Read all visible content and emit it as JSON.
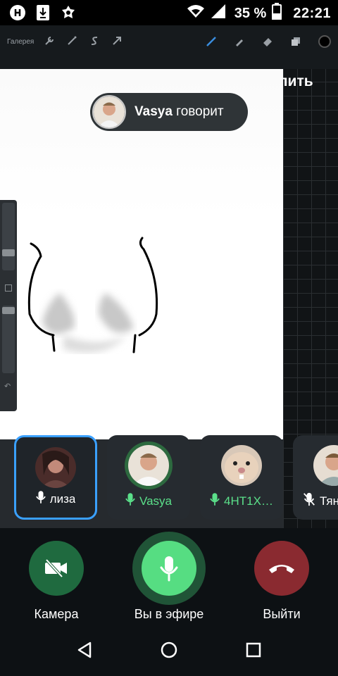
{
  "status_bar": {
    "battery_percent": "35 %",
    "time": "22:21",
    "left_icons": [
      "vk-icon",
      "download-icon",
      "shield-app-icon"
    ],
    "right_icons": [
      "wifi-icon",
      "signal-icon",
      "battery-icon"
    ]
  },
  "drawing_app": {
    "gallery_label": "Галерея",
    "tools": [
      "wrench-icon",
      "magic-icon",
      "s-curve-icon",
      "arrow-icon"
    ],
    "right_tools": [
      "brush-icon",
      "smudge-icon",
      "eraser-icon",
      "layers-icon",
      "color-icon"
    ]
  },
  "header": {
    "pin_label": "Закрепить"
  },
  "speaker_banner": {
    "name": "Vasya",
    "suffix": " говорит"
  },
  "current_speaker": {
    "name": "лиза"
  },
  "participants": [
    {
      "name": "лиза",
      "mic": "on",
      "active": true
    },
    {
      "name": "Vasya",
      "mic": "speaking",
      "active": false
    },
    {
      "name": "4HT1X…",
      "mic": "speaking",
      "active": false
    },
    {
      "name": "Тян",
      "mic": "muted",
      "active": false
    }
  ],
  "controls": {
    "camera_label": "Камера",
    "mic_label": "Вы в эфире",
    "exit_label": "Выйти"
  },
  "colors": {
    "accent_blue": "#3aa0ff",
    "speaking_green": "#5be08a",
    "exit_red": "#8a2a30"
  }
}
